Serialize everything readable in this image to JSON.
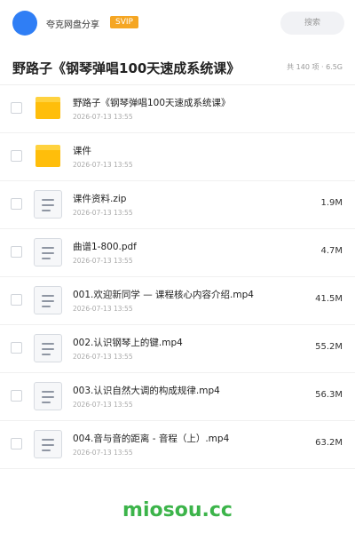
{
  "header": {
    "username": "夸克网盘分享",
    "badge": "SVIP",
    "search_placeholder": "搜索",
    "accent_color": "#2f7ef5",
    "badge_color": "#f5a623"
  },
  "title": {
    "text": "野路子《钢琴弹唱100天速成系统课》",
    "meta": "共 140 项 · 6.5G"
  },
  "files": [
    {
      "type": "folder",
      "icon": "folder-icon",
      "name": "野路子《钢琴弹唱100天速成系统课》",
      "date": "2026-07-13 13:55",
      "size": ""
    },
    {
      "type": "folder",
      "icon": "folder-icon",
      "name": "课件",
      "date": "2026-07-13 13:55",
      "size": ""
    },
    {
      "type": "file",
      "icon": "document-icon",
      "name": "课件资料.zip",
      "date": "2026-07-13 13:55",
      "size": "1.9M"
    },
    {
      "type": "file",
      "icon": "document-icon",
      "name": "曲谱1-800.pdf",
      "date": "2026-07-13 13:55",
      "size": "4.7M"
    },
    {
      "type": "file",
      "icon": "document-icon",
      "name": "001.欢迎新同学 — 课程核心内容介绍.mp4",
      "date": "2026-07-13 13:55",
      "size": "41.5M"
    },
    {
      "type": "file",
      "icon": "document-icon",
      "name": "002.认识钢琴上的键.mp4",
      "date": "2026-07-13 13:55",
      "size": "55.2M"
    },
    {
      "type": "file",
      "icon": "document-icon",
      "name": "003.认识自然大调的构成规律.mp4",
      "date": "2026-07-13 13:55",
      "size": "56.3M"
    },
    {
      "type": "file",
      "icon": "document-icon",
      "name": "004.音与音的距离 - 音程（上）.mp4",
      "date": "2026-07-13 13:55",
      "size": "63.2M"
    }
  ],
  "watermark": "miosou.cc"
}
